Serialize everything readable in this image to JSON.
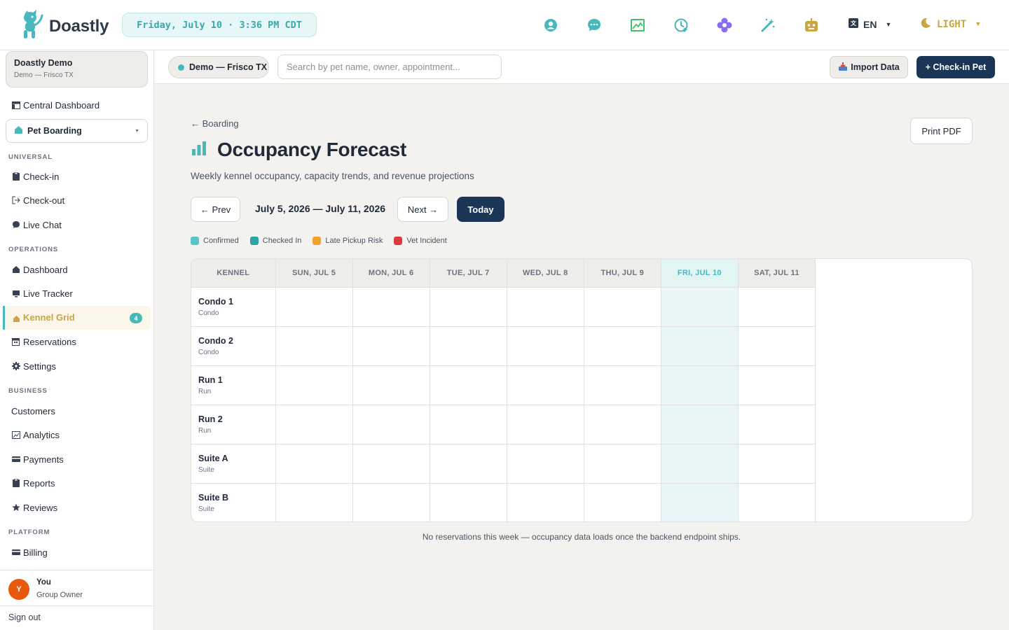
{
  "app": {
    "name": "Doastly",
    "datetime": "Friday, July 10 · 3:36 PM CDT",
    "language": "EN",
    "theme": "LIGHT",
    "colors": {
      "accent": "#48b8bd",
      "navy": "#1b3556",
      "gold": "#c9a641"
    }
  },
  "topbar_icons": [
    "support-icon",
    "chat-icon",
    "image-icon",
    "history-clock-icon",
    "flower-icon",
    "magic-wand-icon",
    "robot-icon"
  ],
  "sidebar": {
    "org_name": "Doastly Demo",
    "org_sub": "Demo — Frisco TX",
    "central_dashboard": "Central Dashboard",
    "module": "Pet Boarding",
    "sections": {
      "universal": "UNIVERSAL",
      "operations": "OPERATIONS",
      "business": "BUSINESS",
      "platform": "PLATFORM"
    },
    "items": {
      "checkin": "Check-in",
      "checkout": "Check-out",
      "livechat": "Live Chat",
      "dashboard": "Dashboard",
      "livetracker": "Live Tracker",
      "kennelgrid": "Kennel Grid",
      "kennelgrid_badge": "4",
      "reservations": "Reservations",
      "settings": "Settings",
      "customers": "Customers",
      "analytics": "Analytics",
      "payments": "Payments",
      "reports": "Reports",
      "reviews": "Reviews",
      "billing": "Billing"
    },
    "user": {
      "initial": "Y",
      "name": "You",
      "role": "Group Owner"
    },
    "signout": "Sign out"
  },
  "toolbar": {
    "location": "Demo — Frisco TX",
    "search_placeholder": "Search by pet name, owner, appointment...",
    "import_label": "Import Data",
    "checkin_label": "+ Check-in Pet"
  },
  "main": {
    "back": "← Boarding",
    "print": "Print PDF",
    "title": "Occupancy Forecast",
    "subtitle": "Weekly kennel occupancy, capacity trends, and revenue projections",
    "prev": "← Prev",
    "range": "July 5, 2026 — July 11, 2026",
    "next": "Next →",
    "today": "Today",
    "legend": [
      {
        "label": "Confirmed",
        "color": "#5bc4c9"
      },
      {
        "label": "Checked In",
        "color": "#2ea3a6"
      },
      {
        "label": "Late Pickup Risk",
        "color": "#f4a12c"
      },
      {
        "label": "Vet Incident",
        "color": "#dc3b3b"
      }
    ],
    "grid": {
      "kennel_header": "KENNEL",
      "days": [
        "SUN, JUL 5",
        "MON, JUL 6",
        "TUE, JUL 7",
        "WED, JUL 8",
        "THU, JUL 9",
        "FRI, JUL 10",
        "SAT, JUL 11"
      ],
      "today_index": 5,
      "kennels": [
        {
          "name": "Condo 1",
          "type": "Condo"
        },
        {
          "name": "Condo 2",
          "type": "Condo"
        },
        {
          "name": "Run 1",
          "type": "Run"
        },
        {
          "name": "Run 2",
          "type": "Run"
        },
        {
          "name": "Suite A",
          "type": "Suite"
        },
        {
          "name": "Suite B",
          "type": "Suite"
        }
      ]
    },
    "empty_note": "No reservations this week — occupancy data loads once the backend endpoint ships."
  }
}
